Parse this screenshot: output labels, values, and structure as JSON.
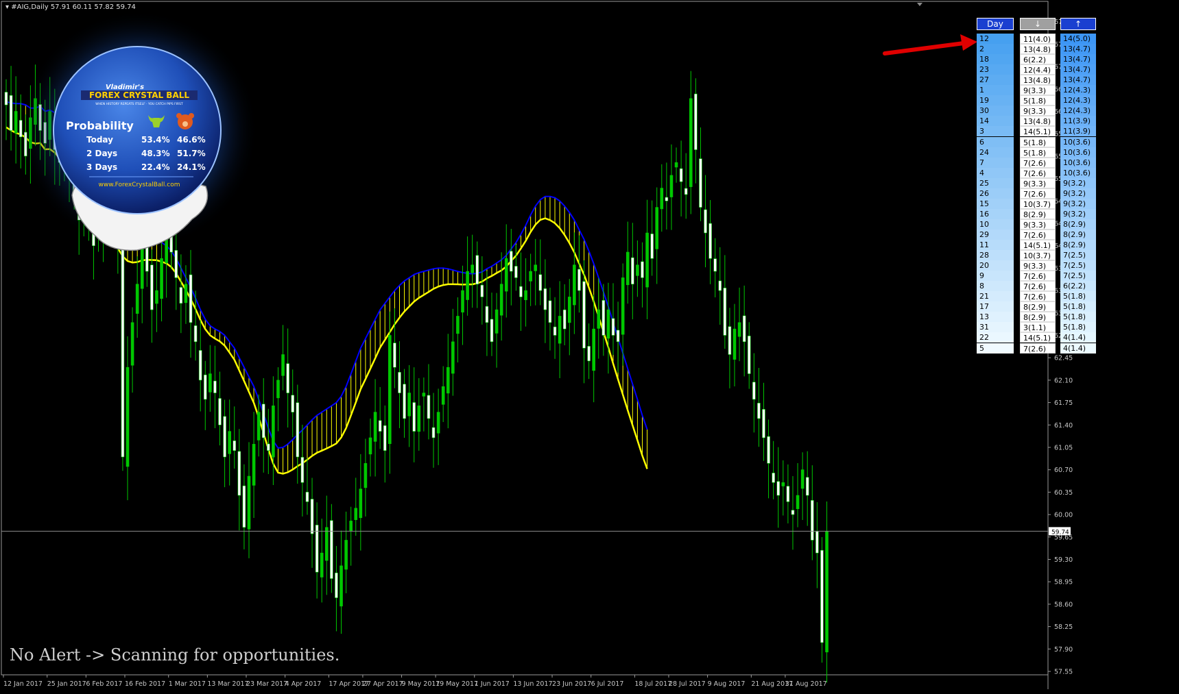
{
  "header": {
    "dropdown_icon": "triangle-down-icon",
    "symbol": "#AIG,Daily",
    "ohlc": "57.91 60.11 57.82 59.74"
  },
  "colors": {
    "background": "#000000",
    "bull_candle": "#00c800",
    "bear_candle": "#ffffff",
    "ma_fast": "#0000ff",
    "ma_slow": "#ffff00",
    "fill_lines": "#ffff00",
    "price_line": "#8c8c8c",
    "arrow": "#e00000"
  },
  "status": {
    "text": "No Alert -> Scanning for opportunities."
  },
  "crystal_ball": {
    "brand_top": "Vladimir's",
    "brand_main": "FOREX CRYSTAL BALL",
    "tagline": "WHEN HISTORY REPEATS ITSELF · YOU CATCH PIPS FIRST",
    "heading": "Probability",
    "bull_icon": "bull-icon",
    "bear_icon": "bear-icon",
    "rows": [
      {
        "label": "Today",
        "bull": "53.4%",
        "bear": "46.6%"
      },
      {
        "label": "2 Days",
        "bull": "48.3%",
        "bear": "51.7%"
      },
      {
        "label": "3 Days",
        "bull": "22.4%",
        "bear": "24.1%"
      }
    ],
    "url": "www.ForexCrystalBall.com"
  },
  "stats_table": {
    "headers": {
      "day": "Day",
      "down_icon": "arrow-down-icon",
      "up_icon": "arrow-up-icon"
    },
    "rows": [
      [
        "12",
        "11(4.0)",
        "14(5.0)"
      ],
      [
        "2",
        "13(4.8)",
        "13(4.7)"
      ],
      [
        "18",
        "6(2.2)",
        "13(4.7)"
      ],
      [
        "23",
        "12(4.4)",
        "13(4.7)"
      ],
      [
        "27",
        "13(4.8)",
        "13(4.7)"
      ],
      [
        "1",
        "9(3.3)",
        "12(4.3)"
      ],
      [
        "19",
        "5(1.8)",
        "12(4.3)"
      ],
      [
        "30",
        "9(3.3)",
        "12(4.3)"
      ],
      [
        "14",
        "13(4.8)",
        "11(3.9)"
      ],
      [
        "3",
        "14(5.1)",
        "11(3.9)"
      ],
      [
        "6",
        "5(1.8)",
        "10(3.6)"
      ],
      [
        "24",
        "5(1.8)",
        "10(3.6)"
      ],
      [
        "7",
        "7(2.6)",
        "10(3.6)"
      ],
      [
        "4",
        "7(2.6)",
        "10(3.6)"
      ],
      [
        "25",
        "9(3.3)",
        "9(3.2)"
      ],
      [
        "26",
        "7(2.6)",
        "9(3.2)"
      ],
      [
        "15",
        "10(3.7)",
        "9(3.2)"
      ],
      [
        "16",
        "8(2.9)",
        "9(3.2)"
      ],
      [
        "10",
        "9(3.3)",
        "8(2.9)"
      ],
      [
        "29",
        "7(2.6)",
        "8(2.9)"
      ],
      [
        "11",
        "14(5.1)",
        "8(2.9)"
      ],
      [
        "28",
        "10(3.7)",
        "7(2.5)"
      ],
      [
        "20",
        "9(3.3)",
        "7(2.5)"
      ],
      [
        "9",
        "7(2.6)",
        "7(2.5)"
      ],
      [
        "8",
        "7(2.6)",
        "6(2.2)"
      ],
      [
        "21",
        "7(2.6)",
        "5(1.8)"
      ],
      [
        "17",
        "8(2.9)",
        "5(1.8)"
      ],
      [
        "13",
        "8(2.9)",
        "5(1.8)"
      ],
      [
        "31",
        "3(1.1)",
        "5(1.8)"
      ],
      [
        "22",
        "14(5.1)",
        "4(1.4)"
      ],
      [
        "5",
        "7(2.6)",
        "4(1.4)"
      ]
    ]
  },
  "chart_data": {
    "type": "candlestick",
    "ylim": [
      57.55,
      67.9
    ],
    "y_ticks": [
      "67.70",
      "67.35",
      "67.00",
      "66.65",
      "66.30",
      "65.95",
      "65.60",
      "65.25",
      "64.90",
      "64.55",
      "64.20",
      "63.85",
      "63.50",
      "63.15",
      "62.80",
      "62.45",
      "62.10",
      "61.75",
      "61.40",
      "61.05",
      "60.70",
      "60.35",
      "60.00",
      "59.65",
      "59.30",
      "58.95",
      "58.60",
      "58.25",
      "57.90",
      "57.55"
    ],
    "x_labels": [
      "12 Jan 2017",
      "25 Jan 2017",
      "6 Feb 2017",
      "16 Feb 2017",
      "1 Mar 2017",
      "13 Mar 2017",
      "23 Mar 2017",
      "4 Apr 2017",
      "17 Apr 2017",
      "27 Apr 2017",
      "9 May 2017",
      "19 May 2017",
      "1 Jun 2017",
      "13 Jun 2017",
      "23 Jun 2017",
      "6 Jul 2017",
      "18 Jul 2017",
      "28 Jul 2017",
      "9 Aug 2017",
      "21 Aug 2017",
      "31 Aug 2017"
    ],
    "x_label_bar_index": [
      0,
      9,
      17,
      25,
      34,
      42,
      50,
      58,
      67,
      74,
      82,
      89,
      97,
      105,
      113,
      121,
      130,
      137,
      145,
      154,
      161
    ],
    "current_price": "59.74",
    "closes": [
      66.4,
      66.0,
      66.3,
      65.9,
      65.6,
      66.2,
      66.5,
      66.0,
      65.8,
      66.3,
      65.7,
      65.5,
      65.9,
      65.4,
      65.0,
      64.6,
      65.1,
      64.7,
      64.2,
      64.4,
      64.8,
      65.1,
      64.7,
      64.3,
      60.9,
      62.3,
      63.0,
      63.6,
      64.3,
      63.8,
      63.2,
      63.5,
      64.0,
      64.4,
      64.1,
      63.7,
      63.3,
      63.6,
      63.0,
      62.7,
      62.1,
      61.8,
      62.2,
      61.9,
      61.4,
      60.9,
      61.3,
      61.0,
      60.3,
      59.8,
      60.6,
      61.1,
      61.6,
      61.2,
      61.0,
      61.7,
      62.1,
      62.5,
      61.9,
      61.6,
      60.9,
      60.5,
      60.2,
      59.7,
      59.1,
      59.4,
      59.8,
      59.0,
      58.7,
      59.2,
      59.6,
      59.9,
      60.1,
      60.4,
      60.8,
      61.2,
      61.6,
      61.3,
      61.0,
      62.8,
      62.3,
      61.9,
      61.5,
      61.9,
      61.3,
      61.7,
      61.9,
      61.5,
      61.2,
      61.6,
      62.0,
      62.3,
      62.7,
      63.1,
      63.5,
      63.8,
      63.9,
      63.6,
      63.4,
      63.0,
      62.7,
      63.2,
      63.6,
      64.0,
      63.8,
      63.7,
      63.4,
      63.5,
      63.8,
      63.9,
      63.5,
      63.2,
      63.0,
      62.8,
      63.1,
      62.9,
      63.4,
      63.9,
      63.5,
      62.6,
      62.4,
      62.9,
      63.2,
      62.8,
      63.2,
      62.8,
      62.7,
      63.7,
      64.1,
      63.6,
      63.9,
      63.7,
      64.4,
      64.0,
      64.8,
      65.1,
      64.9,
      65.3,
      65.5,
      65.2,
      65.0,
      66.5,
      65.7,
      64.8,
      64.4,
      64.0,
      63.8,
      63.5,
      62.8,
      62.5,
      62.9,
      63.0,
      62.7,
      62.2,
      61.8,
      61.5,
      61.2,
      60.8,
      60.5,
      60.3,
      60.5,
      60.2,
      60.0,
      60.3,
      60.7,
      60.3,
      59.6,
      59.4,
      58.0,
      59.74
    ],
    "ma_fast": [
      66.45,
      66.43,
      66.42,
      66.42,
      66.4,
      66.35,
      66.35,
      66.38,
      66.3,
      66.32,
      66.28,
      66.2,
      66.1,
      66.0,
      65.9,
      65.8,
      65.7,
      65.6,
      65.45,
      65.3,
      65.15,
      65.0,
      64.85,
      64.7,
      64.55,
      64.45,
      64.4,
      64.38,
      64.38,
      64.36,
      64.33,
      64.3,
      64.25,
      64.2,
      64.12,
      64.0,
      63.85,
      63.7,
      63.55,
      63.38,
      63.2,
      63.05,
      62.95,
      62.9,
      62.86,
      62.8,
      62.7,
      62.6,
      62.45,
      62.3,
      62.15,
      62.0,
      61.8,
      61.58,
      61.35,
      61.15,
      61.04,
      61.05,
      61.1,
      61.17,
      61.25,
      61.32,
      61.4,
      61.48,
      61.55,
      61.6,
      61.65,
      61.7,
      61.75,
      61.85,
      62.0,
      62.2,
      62.4,
      62.6,
      62.75,
      62.9,
      63.05,
      63.2,
      63.3,
      63.4,
      63.5,
      63.58,
      63.65,
      63.7,
      63.75,
      63.78,
      63.8,
      63.82,
      63.84,
      63.85,
      63.85,
      63.84,
      63.82,
      63.8,
      63.78,
      63.77,
      63.76,
      63.77,
      63.79,
      63.84,
      63.88,
      63.93,
      63.98,
      64.05,
      64.15,
      64.25,
      64.38,
      64.52,
      64.68,
      64.82,
      64.92,
      64.97,
      64.97,
      64.95,
      64.9,
      64.82,
      64.72,
      64.6,
      64.45,
      64.3,
      64.12,
      63.92,
      63.7,
      63.48,
      63.25,
      63.0,
      62.76,
      62.52,
      62.28,
      62.04,
      61.8,
      61.55,
      61.33
    ]
  },
  "annotation": {
    "arrow_label": ""
  }
}
